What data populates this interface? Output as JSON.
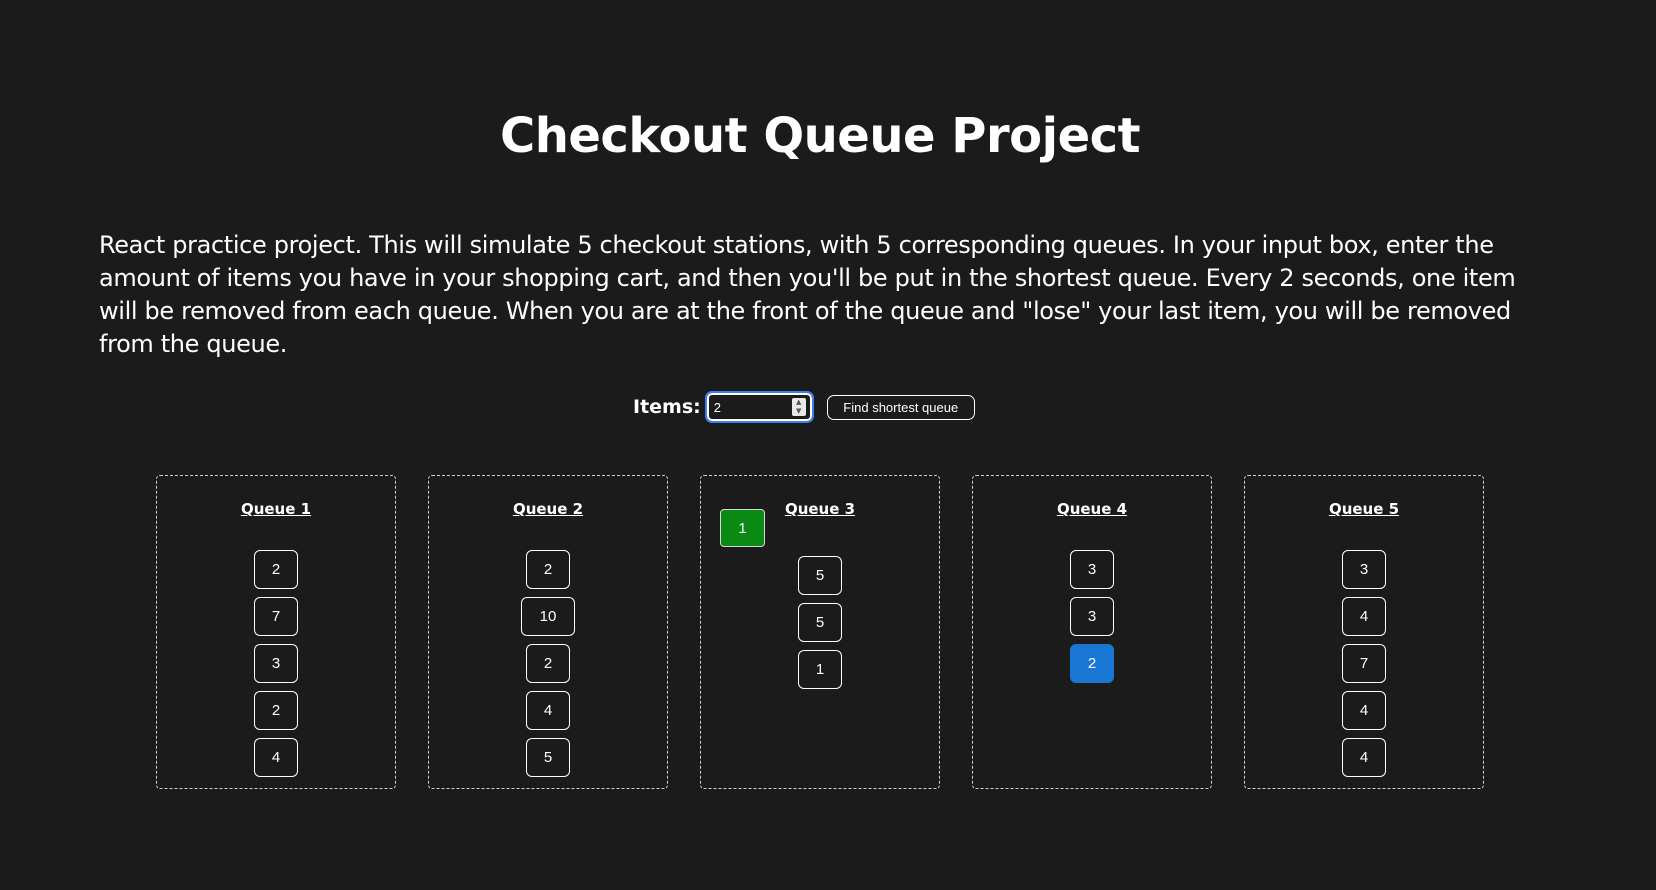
{
  "page": {
    "title": "Checkout Queue Project",
    "description": "React practice project. This will simulate 5 checkout stations, with 5 corresponding queues. In your input box, enter the amount of items you have in your shopping cart, and then you'll be put in the shortest queue. Every 2 seconds, one item will be removed from each queue. When you are at the front of the queue and \"lose\" your last item, you will be removed from the queue."
  },
  "controls": {
    "items_label": "Items:",
    "items_value": "2",
    "find_button_label": "Find shortest queue"
  },
  "queues": [
    {
      "title": "Queue 1",
      "served": null,
      "items": [
        "2",
        "7",
        "3",
        "2",
        "4"
      ]
    },
    {
      "title": "Queue 2",
      "served": null,
      "items": [
        "2",
        "10",
        "2",
        "4",
        "5"
      ]
    },
    {
      "title": "Queue 3",
      "served": "1",
      "items": [
        "5",
        "5",
        "1"
      ]
    },
    {
      "title": "Queue 4",
      "served": null,
      "items": [
        "3",
        "3",
        "2"
      ]
    },
    {
      "title": "Queue 5",
      "served": null,
      "items": [
        "3",
        "4",
        "7",
        "4",
        "4"
      ]
    }
  ],
  "colors": {
    "background": "#1b1b1b",
    "served_badge": "#0a8a14",
    "user_item_highlight": "#1976d2",
    "input_focus_ring": "#3f7ff0"
  },
  "highlighted_item": {
    "queue": "Queue 4",
    "index": 2
  }
}
